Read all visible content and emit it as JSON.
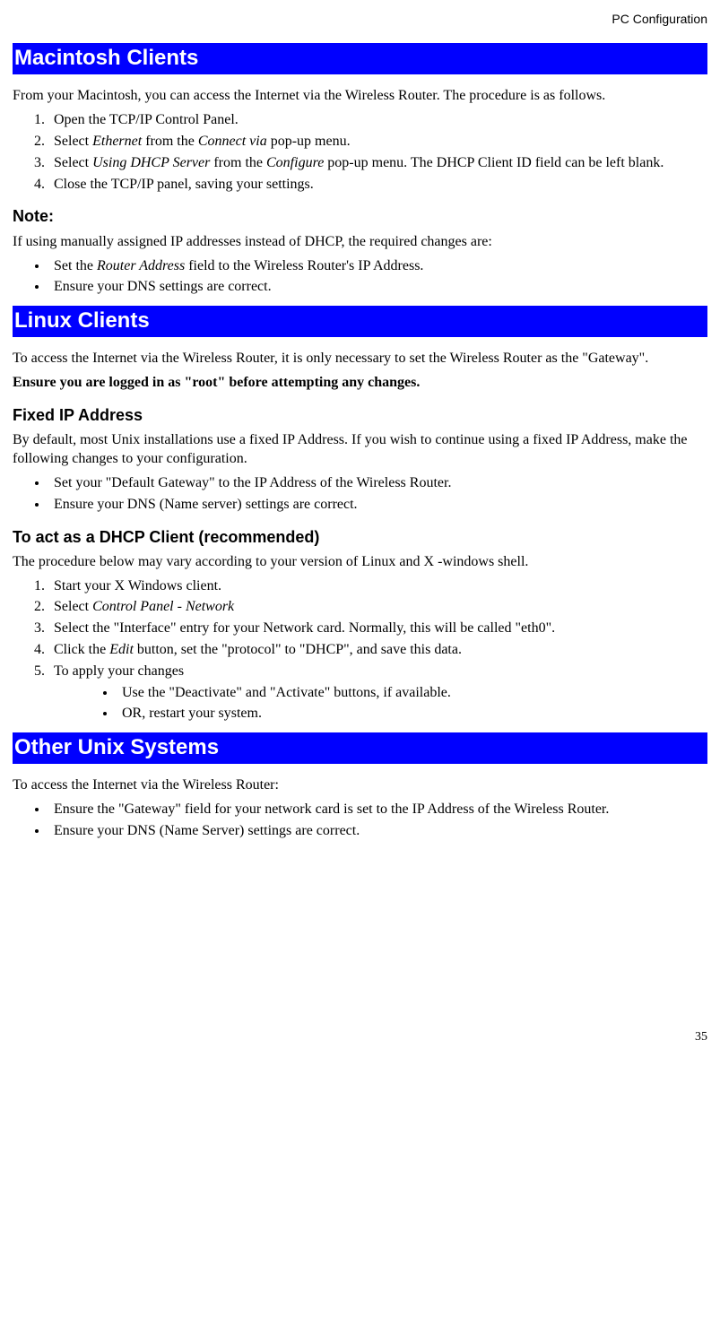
{
  "running_header": "PC Configuration",
  "page_number": "35",
  "mac": {
    "heading": "Macintosh Clients",
    "intro": "From your Macintosh, you can access the Internet via the Wireless Router. The procedure is as follows.",
    "steps": {
      "s1": "Open the TCP/IP Control Panel.",
      "s2a": "Select ",
      "s2b": "Ethernet",
      "s2c": " from the ",
      "s2d": "Connect via",
      "s2e": " pop-up menu.",
      "s3a": "Select ",
      "s3b": "Using DHCP Server",
      "s3c": " from the ",
      "s3d": "Configure",
      "s3e": " pop-up menu. The DHCP Client ID field can be left blank.",
      "s4": "Close the TCP/IP panel, saving your settings."
    },
    "note_heading": "Note:",
    "note_intro": "If using manually assigned IP addresses instead of DHCP, the required changes are:",
    "note_bullets": {
      "b1a": "Set the ",
      "b1b": "Router Address",
      "b1c": " field to the Wireless Router's IP Address.",
      "b2": "Ensure your DNS settings are correct."
    }
  },
  "linux": {
    "heading": "Linux Clients",
    "intro": "To access the Internet via the Wireless Router, it is only necessary to set the Wireless Router as the \"Gateway\".",
    "root_line": "Ensure you are logged in as \"root\" before attempting any changes.",
    "fixed_heading": "Fixed IP Address",
    "fixed_intro": "By default, most Unix installations use a fixed IP Address. If you wish to continue using a fixed IP Address, make the following changes to your configuration.",
    "fixed_bullets": {
      "b1": "Set your \"Default Gateway\" to the IP Address of the Wireless Router.",
      "b2": "Ensure your DNS (Name server) settings are correct."
    },
    "dhcp_heading": "To act as a DHCP Client (recommended)",
    "dhcp_intro": "The procedure below may vary according to your version of Linux and X -windows shell.",
    "dhcp_steps": {
      "s1": "Start your X Windows client.",
      "s2a": "Select ",
      "s2b": "Control Panel - Network",
      "s3": "Select the \"Interface\" entry for your Network card. Normally, this will be called \"eth0\".",
      "s4a": "Click the ",
      "s4b": "Edit",
      "s4c": " button, set the \"protocol\" to \"DHCP\", and save this data.",
      "s5": "To apply your changes",
      "s5sub1": "Use the \"Deactivate\" and \"Activate\" buttons, if available.",
      "s5sub2": "OR, restart your system."
    }
  },
  "unix": {
    "heading": "Other Unix Systems",
    "intro": "To access the Internet via the Wireless Router:",
    "bullets": {
      "b1": "Ensure the \"Gateway\" field for your network card is set to the IP Address of the Wireless Router.",
      "b2": "Ensure your DNS (Name Server) settings are correct."
    }
  }
}
